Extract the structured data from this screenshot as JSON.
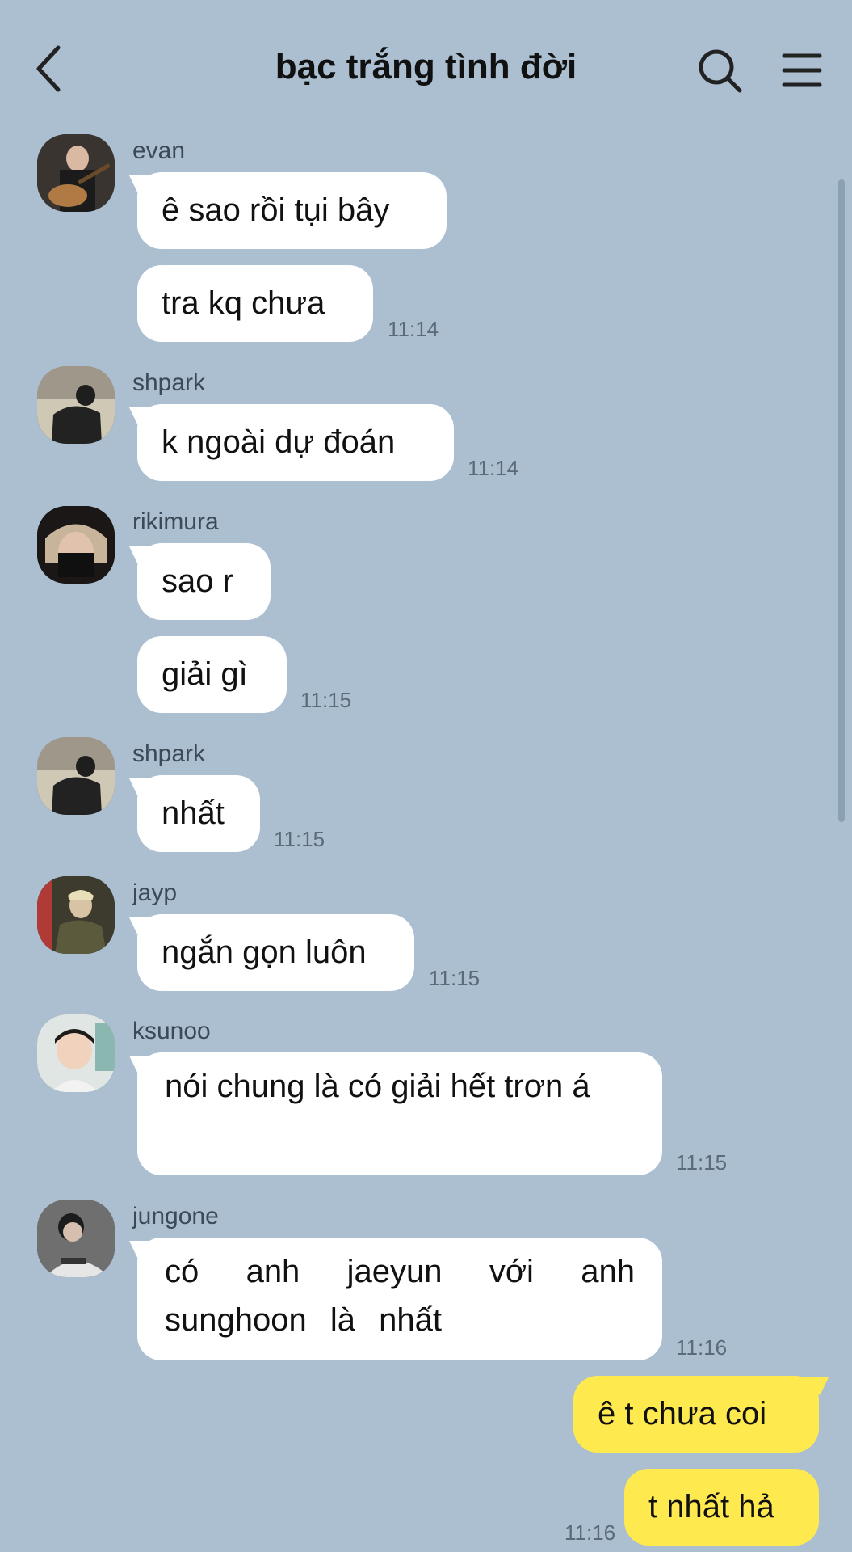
{
  "header": {
    "title": "bạc trắng tình đời"
  },
  "colors": {
    "background": "#abbfd1",
    "incoming_bubble": "#ffffff",
    "outgoing_bubble": "#fee94f"
  },
  "messages": [
    {
      "sender": "evan",
      "text": "ê sao rồi tụi bây"
    },
    {
      "text": "tra kq chưa",
      "time": "11:14"
    },
    {
      "sender": "shpark",
      "text": "k ngoài dự đoán",
      "time": "11:14"
    },
    {
      "sender": "rikimura",
      "text": "sao r"
    },
    {
      "text": "giải gì",
      "time": "11:15"
    },
    {
      "sender": "shpark",
      "text": "nhất",
      "time": "11:15"
    },
    {
      "sender": "jayp",
      "text": "ngắn gọn luôn",
      "time": "11:15"
    },
    {
      "sender": "ksunoo",
      "text": "nói chung là có giải hết trơn á",
      "time": "11:15"
    },
    {
      "sender": "jungone",
      "text": "có anh jaeyun với anh sunghoon là nhất",
      "time": "11:16"
    },
    {
      "text": "ê t chưa coi",
      "outgoing": true
    },
    {
      "text": "t nhất hả",
      "outgoing": true,
      "time": "11:16"
    }
  ]
}
